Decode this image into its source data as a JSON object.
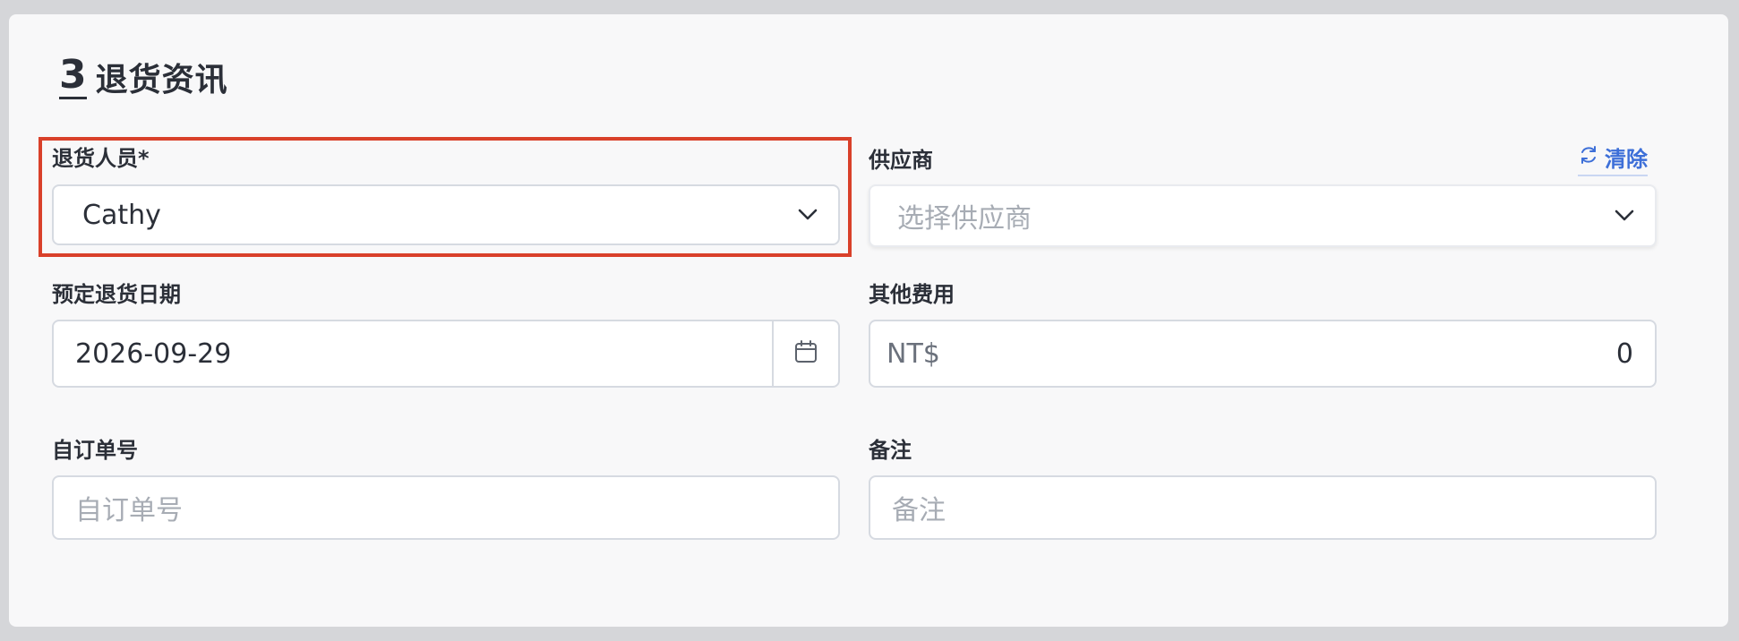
{
  "section": {
    "step": "3",
    "title": "退货资讯"
  },
  "return_person": {
    "label": "退货人员*",
    "value": "Cathy"
  },
  "supplier": {
    "label": "供应商",
    "placeholder": "选择供应商",
    "clear_label": "清除"
  },
  "return_date": {
    "label": "预定退货日期",
    "value": "2026-09-29"
  },
  "other_fee": {
    "label": "其他费用",
    "currency": "NT$",
    "value": "0"
  },
  "custom_order": {
    "label": "自订单号",
    "placeholder": "自订单号"
  },
  "note": {
    "label": "备注",
    "placeholder": "备注"
  },
  "icons": {
    "select_chevron": "chevron-down-icon",
    "calendar": "calendar-icon",
    "refresh": "refresh-icon"
  },
  "colors": {
    "highlight": "#d9402a",
    "link": "#3d6fd8",
    "text": "#2b2f38",
    "placeholder": "#a7acb4",
    "border": "#d6dae1"
  }
}
